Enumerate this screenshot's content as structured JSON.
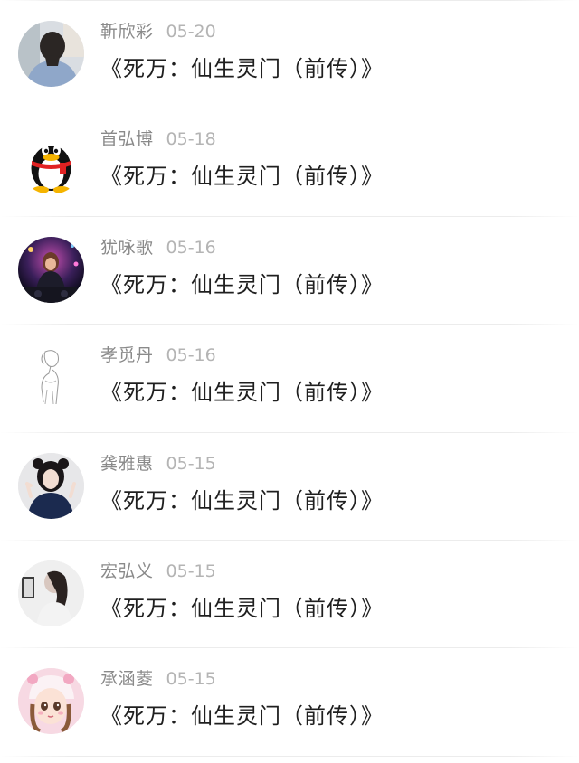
{
  "comments": [
    {
      "name": "靳欣彩",
      "date": "05-20",
      "text": "《死万：仙生灵门（前传）》",
      "avatar": "photo-girl-back"
    },
    {
      "name": "首弘博",
      "date": "05-18",
      "text": "《死万：仙生灵门（前传）》",
      "avatar": "qq-penguin"
    },
    {
      "name": "犹咏歌",
      "date": "05-16",
      "text": "《死万：仙生灵门（前传）》",
      "avatar": "dj-girl"
    },
    {
      "name": "孝觅丹",
      "date": "05-16",
      "text": "《死万：仙生灵门（前传）》",
      "avatar": "sketch-figure"
    },
    {
      "name": "龚雅惠",
      "date": "05-15",
      "text": "《死万：仙生灵门（前传）》",
      "avatar": "girl-peace-sign"
    },
    {
      "name": "宏弘义",
      "date": "05-15",
      "text": "《死万：仙生灵门（前传）》",
      "avatar": "girl-hair-photo"
    },
    {
      "name": "承涵菱",
      "date": "05-15",
      "text": "《死万：仙生灵门（前传）》",
      "avatar": "cartoon-girl"
    }
  ]
}
